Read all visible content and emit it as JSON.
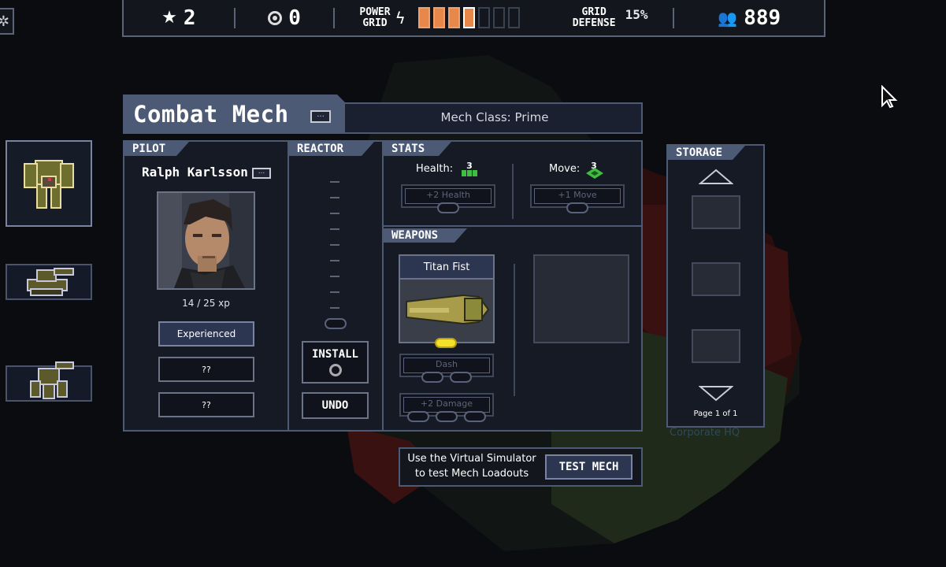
{
  "topbar": {
    "stars": "2",
    "reputation": "0",
    "power_grid_label_1": "POWER",
    "power_grid_label_2": "GRID",
    "power_filled": 4,
    "power_total": 7,
    "grid_defense_label_1": "GRID",
    "grid_defense_label_2": "DEFENSE",
    "grid_defense_value": "15%",
    "population": "889"
  },
  "mech": {
    "name": "Combat Mech",
    "class_text": "Mech Class: Prime"
  },
  "pilot": {
    "section": "PILOT",
    "name": "Ralph Karlsson",
    "xp": "14 / 25 xp",
    "skill_1": "Experienced",
    "skill_2": "??",
    "skill_3": "??"
  },
  "reactor": {
    "section": "REACTOR",
    "install_label": "INSTALL",
    "undo_label": "UNDO"
  },
  "stats": {
    "section": "STATS",
    "health_label": "Health:",
    "health_value": "3",
    "health_upgrade": "+2 Health",
    "move_label": "Move:",
    "move_value": "3",
    "move_upgrade": "+1 Move"
  },
  "weapons": {
    "section": "WEAPONS",
    "weapon_name": "Titan Fist",
    "upgrade_1": "Dash",
    "upgrade_2": "+2 Damage"
  },
  "storage": {
    "section": "STORAGE",
    "page": "Page 1 of 1"
  },
  "test": {
    "line_1": "Use the Virtual Simulator",
    "line_2": "to test Mech Loadouts",
    "button": "TEST MECH"
  },
  "colors": {
    "power_on": "#e8874a",
    "panel_border": "#4d5a75",
    "green_stat": "#3fbf3f",
    "weapon_pip": "#f5e02a"
  }
}
